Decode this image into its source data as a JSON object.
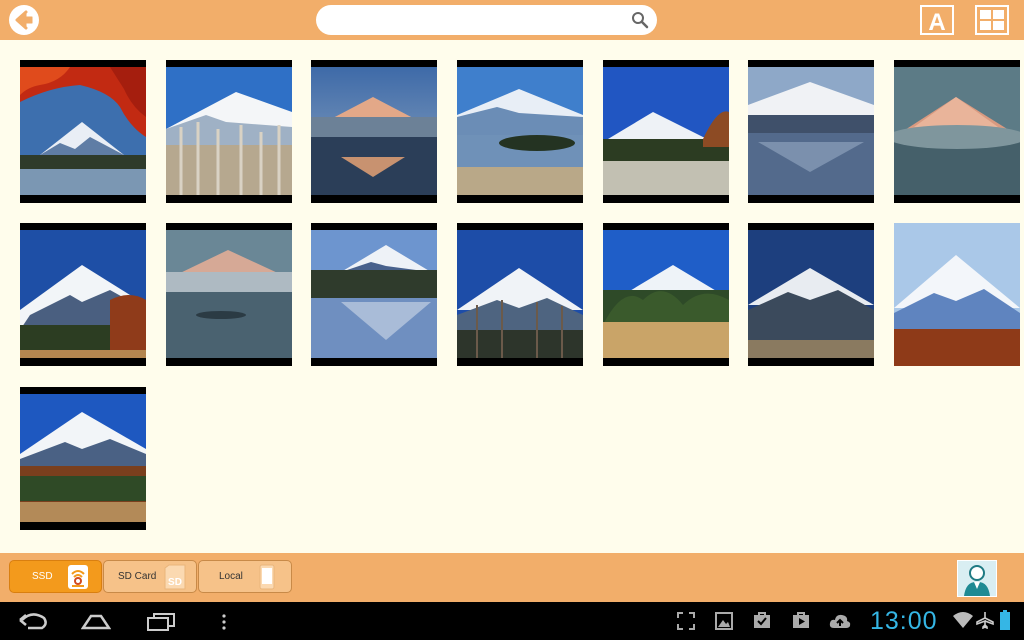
{
  "search": {
    "value": "",
    "placeholder": ""
  },
  "header": {
    "font_button": "A"
  },
  "gallery": {
    "photos": [
      {
        "name": "photo-fuji-autumn-maple"
      },
      {
        "name": "photo-fuji-frosted-trees"
      },
      {
        "name": "photo-fuji-dawn-lake"
      },
      {
        "name": "photo-fuji-lake-island"
      },
      {
        "name": "photo-fuji-blue-sky"
      },
      {
        "name": "photo-fuji-mist-reflection"
      },
      {
        "name": "photo-fuji-pink-cloud"
      },
      {
        "name": "photo-fuji-snow-forest"
      },
      {
        "name": "photo-fuji-fog-lake"
      },
      {
        "name": "photo-fuji-lake-shore"
      },
      {
        "name": "photo-fuji-bare-trees"
      },
      {
        "name": "photo-fuji-golden-grass"
      },
      {
        "name": "photo-fuji-dark-slopes"
      },
      {
        "name": "photo-fuji-red-forest"
      },
      {
        "name": "photo-fuji-autumn-field"
      }
    ]
  },
  "source_tabs": [
    {
      "label": "SSD",
      "icon": "wifi-drive-icon",
      "active": true
    },
    {
      "label": "SD Card",
      "icon": "sd-card-icon",
      "active": false
    },
    {
      "label": "Local",
      "icon": "phone-icon",
      "active": false
    }
  ],
  "system": {
    "clock": "13:00"
  },
  "colors": {
    "bar": "#f2ae6a",
    "content_bg": "#fffdec",
    "active_tab": "#f39a1c",
    "clock": "#35b6e5"
  }
}
